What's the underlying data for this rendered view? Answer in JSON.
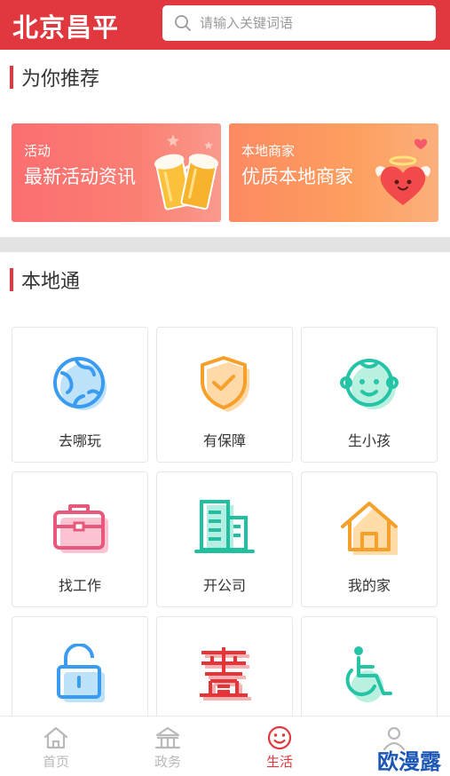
{
  "header": {
    "logo": "北京昌平",
    "search_placeholder": "请输入关键词语"
  },
  "recommend": {
    "title": "为你推荐",
    "banners": [
      {
        "small": "活动",
        "big": "最新活动资讯",
        "icon": "beer-mugs-icon"
      },
      {
        "small": "本地商家",
        "big": "优质本地商家",
        "icon": "winged-heart-icon"
      }
    ]
  },
  "local": {
    "title": "本地通",
    "items": [
      {
        "label": "去哪玩",
        "icon": "globe-icon"
      },
      {
        "label": "有保障",
        "icon": "shield-check-icon"
      },
      {
        "label": "生小孩",
        "icon": "baby-face-icon"
      },
      {
        "label": "找工作",
        "icon": "briefcase-icon"
      },
      {
        "label": "开公司",
        "icon": "office-building-icon"
      },
      {
        "label": "我的家",
        "icon": "house-icon"
      },
      {
        "label": "",
        "icon": "padlock-icon"
      },
      {
        "label": "",
        "icon": "double-happiness-icon"
      },
      {
        "label": "",
        "icon": "wheelchair-icon"
      }
    ]
  },
  "tabs": [
    {
      "label": "首页",
      "icon": "home-icon",
      "active": false
    },
    {
      "label": "政务",
      "icon": "government-building-icon",
      "active": false
    },
    {
      "label": "生活",
      "icon": "smile-icon",
      "active": true
    },
    {
      "label": "",
      "icon": "user-icon",
      "active": false
    }
  ],
  "watermark": "欧漫露",
  "colors": {
    "brand": "#e0383e",
    "tab_inactive": "#b9b9b9"
  }
}
